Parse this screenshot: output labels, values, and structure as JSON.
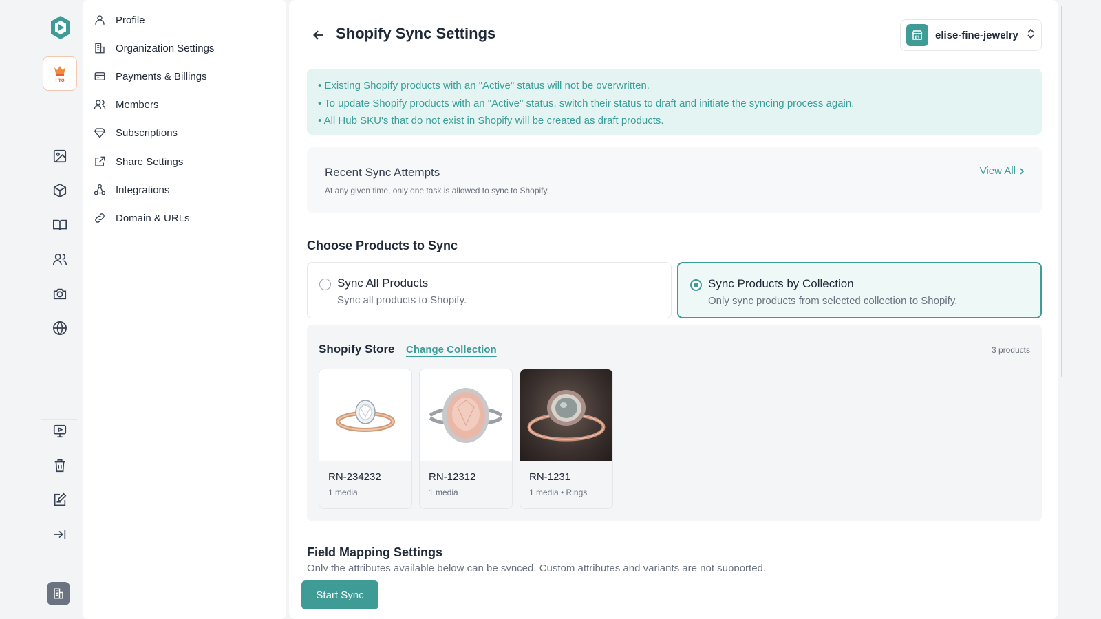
{
  "rail": {
    "pro_label": "Pro",
    "icons": [
      "image-icon",
      "box-icon",
      "book-icon",
      "users-icon",
      "camera-icon",
      "globe-icon",
      "presentation-icon",
      "trash-icon",
      "edit-checklist-icon",
      "collapse-icon"
    ]
  },
  "menu": {
    "items": [
      {
        "label": "Profile",
        "icon": "user-icon"
      },
      {
        "label": "Organization Settings",
        "icon": "building-icon"
      },
      {
        "label": "Payments & Billings",
        "icon": "card-icon"
      },
      {
        "label": "Members",
        "icon": "users-icon"
      },
      {
        "label": "Subscriptions",
        "icon": "diamond-icon"
      },
      {
        "label": "Share Settings",
        "icon": "external-link-icon"
      },
      {
        "label": "Integrations",
        "icon": "integrations-icon"
      },
      {
        "label": "Domain & URLs",
        "icon": "link-icon"
      }
    ]
  },
  "header": {
    "title": "Shopify Sync Settings",
    "store_name": "elise-fine-jewelry"
  },
  "notice": [
    "• Existing Shopify products with an \"Active\" status will not be overwritten.",
    "• To update Shopify products with an \"Active\" status, switch their status to draft and initiate the syncing process again.",
    "• All Hub SKU's that do not exist in Shopify will be created as draft products."
  ],
  "recent": {
    "title": "Recent Sync Attempts",
    "subtitle": "At any given time, only one task is allowed to sync to Shopify.",
    "view_all": "View All"
  },
  "choose": {
    "title": "Choose Products to Sync",
    "options": [
      {
        "title": "Sync All Products",
        "desc": "Sync all products to Shopify.",
        "selected": false
      },
      {
        "title": "Sync Products by Collection",
        "desc": "Only sync products from selected collection to Shopify.",
        "selected": true
      }
    ]
  },
  "collection": {
    "title": "Shopify Store",
    "change_label": "Change Collection",
    "count": "3 products",
    "products": [
      {
        "sku": "RN-234232",
        "meta": "1 media"
      },
      {
        "sku": "RN-12312",
        "meta": "1 media"
      },
      {
        "sku": "RN-1231",
        "meta": "1 media • Rings"
      }
    ]
  },
  "field_mapping": {
    "title": "Field Mapping Settings",
    "subtitle": "Only the attributes available below can be synced. Custom attributes and variants are not supported."
  },
  "footer": {
    "start_label": "Start Sync"
  },
  "colors": {
    "accent": "#3e9b96",
    "notice_bg": "#e4f4f2",
    "pro": "#e0642b"
  }
}
